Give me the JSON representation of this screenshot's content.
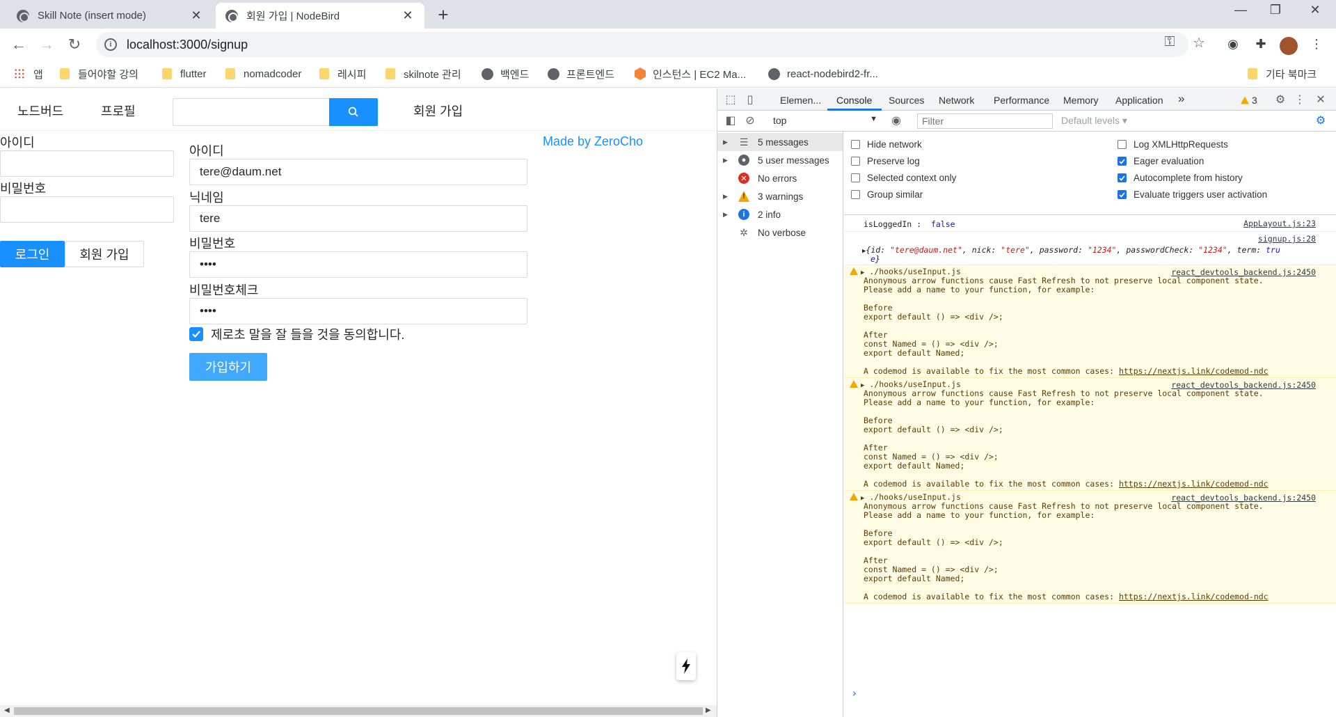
{
  "browser": {
    "tabs": [
      {
        "title": "Skill Note (insert mode)",
        "active": false
      },
      {
        "title": "회원 가입 | NodeBird",
        "active": true
      }
    ],
    "url": "localhost:3000/signup",
    "bookmarks": [
      {
        "label": "앱",
        "icon": "apps-icon"
      },
      {
        "label": "들어야할 강의",
        "icon": "folder-icon"
      },
      {
        "label": "flutter",
        "icon": "folder-icon"
      },
      {
        "label": "nomadcoder",
        "icon": "folder-icon"
      },
      {
        "label": "레시피",
        "icon": "folder-icon"
      },
      {
        "label": "skilnote 관리",
        "icon": "folder-icon"
      },
      {
        "label": "백엔드",
        "icon": "globe-icon"
      },
      {
        "label": "프론트엔드",
        "icon": "globe-icon"
      },
      {
        "label": "인스턴스 | EC2 Ma...",
        "icon": "aws-icon"
      },
      {
        "label": "react-nodebird2-fr...",
        "icon": "globe-icon"
      },
      {
        "label": "기타 북마크",
        "icon": "folder-icon"
      }
    ]
  },
  "app": {
    "menu": {
      "home": "노드버드",
      "profile": "프로필",
      "signup": "회원 가입"
    },
    "search": {
      "value": ""
    },
    "login_form": {
      "id_label": "아이디",
      "password_label": "비밀번호",
      "login_button": "로그인",
      "signup_button": "회원 가입"
    },
    "signup_form": {
      "id_label": "아이디",
      "id_value": "tere@daum.net",
      "nick_label": "닉네임",
      "nick_value": "tere",
      "password_label": "비밀번호",
      "password_value": "••••",
      "password_check_label": "비밀번호체크",
      "password_check_value": "••••",
      "agree_label": "제로초 말을 잘 들을 것을 동의합니다.",
      "agree_checked": true,
      "submit_button": "가입하기"
    },
    "made_by": "Made by ZeroCho"
  },
  "devtools": {
    "tabs": [
      "Elemen...",
      "Console",
      "Sources",
      "Network",
      "Performance",
      "Memory",
      "Application"
    ],
    "active_tab": "Console",
    "more_tabs": "»",
    "warning_count": "3",
    "context": "top",
    "filter_placeholder": "Filter",
    "default_levels": "Default levels ▾",
    "sidebar": [
      {
        "label": "5 messages",
        "icon": "list-icon",
        "expandable": true,
        "selected": true
      },
      {
        "label": "5 user messages",
        "icon": "user-icon",
        "expandable": true,
        "selected": false
      },
      {
        "label": "No errors",
        "icon": "error-icon",
        "expandable": false,
        "selected": false
      },
      {
        "label": "3 warnings",
        "icon": "warning-icon",
        "expandable": true,
        "selected": false
      },
      {
        "label": "2 info",
        "icon": "info-icon",
        "expandable": true,
        "selected": false
      },
      {
        "label": "No verbose",
        "icon": "bug-icon",
        "expandable": false,
        "selected": false
      }
    ],
    "options": {
      "hide_network": {
        "label": "Hide network",
        "checked": false
      },
      "preserve_log": {
        "label": "Preserve log",
        "checked": false
      },
      "selected_context": {
        "label": "Selected context only",
        "checked": false
      },
      "group_similar": {
        "label": "Group similar",
        "checked": false
      },
      "log_xhr": {
        "label": "Log XMLHttpRequests",
        "checked": false
      },
      "eager_eval": {
        "label": "Eager evaluation",
        "checked": true
      },
      "autocomplete": {
        "label": "Autocomplete from history",
        "checked": true
      },
      "eval_triggers": {
        "label": "Evaluate triggers user activation",
        "checked": true
      }
    },
    "logs": {
      "log1": {
        "text_label": "isLoggedIn : ",
        "text_value": "false",
        "source": "AppLayout.js:23"
      },
      "log2": {
        "source": "signup.js:28",
        "obj_open": "{id: ",
        "id": "\"tere@daum.net\"",
        "nick_key": ", nick: ",
        "nick": "\"tere\"",
        "pw_key": ", password: ",
        "pw": "\"1234\"",
        "pwc_key": ", passwordCheck: ",
        "pwc": "\"1234\"",
        "term_key": ", term: ",
        "term_a": "tru",
        "term_b": "e",
        "obj_close": "}"
      },
      "warn": {
        "title": "./hooks/useInput.js",
        "source": "react_devtools_backend.js:2450",
        "l1": "Anonymous arrow functions cause Fast Refresh to not preserve local component state.",
        "l2": "Please add a name to your function, for example:",
        "l3": "Before",
        "l4": "export default () => <div />;",
        "l5": "After",
        "l6": "const Named = () => <div />;",
        "l7": "export default Named;",
        "l8": "A codemod is available to fix the most common cases: ",
        "l8_link": "https://nextjs.link/codemod-ndc"
      }
    },
    "prompt": "›"
  }
}
